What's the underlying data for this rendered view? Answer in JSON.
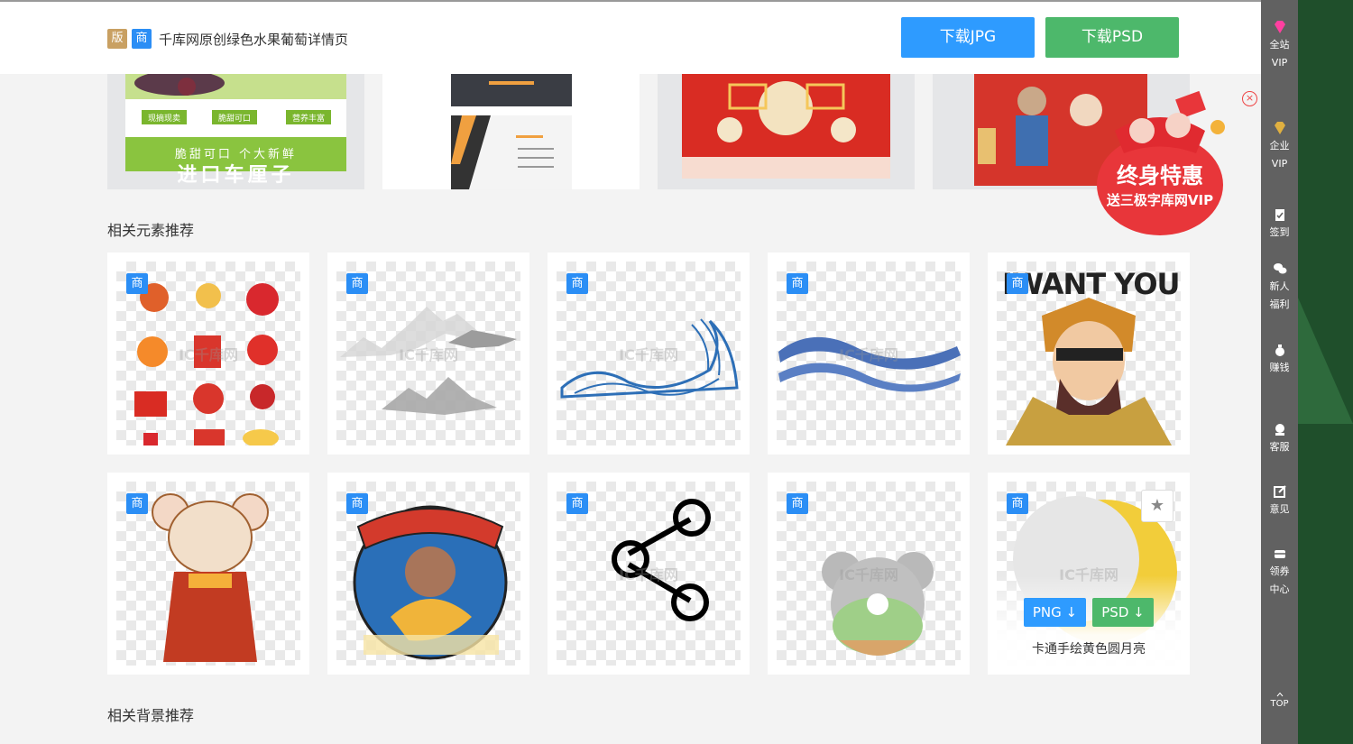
{
  "header": {
    "badge_ban": "版",
    "badge_shang": "商",
    "title": "千库网原创绿色水果葡萄详情页",
    "download_jpg": "下载JPG",
    "download_psd": "下载PSD"
  },
  "sidebar": {
    "items": [
      {
        "label_1": "全站",
        "label_2": "VIP",
        "icon": "diamond-icon"
      },
      {
        "label_1": "企业",
        "label_2": "VIP",
        "icon": "enterprise-diamond-icon"
      },
      {
        "label_1": "签到",
        "icon": "clipboard-check-icon"
      },
      {
        "label_1": "新人",
        "label_2": "福利",
        "icon": "wechat-icon"
      },
      {
        "label_1": "赚钱",
        "icon": "money-bag-icon"
      },
      {
        "label_1": "客服",
        "icon": "customer-service-icon"
      },
      {
        "label_1": "意见",
        "icon": "edit-icon"
      },
      {
        "label_1": "领券",
        "label_2": "中心",
        "icon": "coupon-icon"
      }
    ],
    "top": "TOP"
  },
  "templates_row": {
    "tpl1_tags": [
      "现摘现卖",
      "脆甜可口",
      "营养丰富"
    ],
    "tpl1_slogan": "脆甜可口 个大新鲜",
    "tpl1_headline": "进口车厘子"
  },
  "promo": {
    "line1": "终身特惠",
    "line2": "送三极字库网VIP",
    "close": "×"
  },
  "sections": {
    "elements_title": "相关元素推荐",
    "backgrounds_title": "相关背景推荐"
  },
  "cards": {
    "shang": "商",
    "watermark": "IC千库网",
    "wanted_text": "WANT YOU",
    "moon_caption": "卡通手绘黄色圆月亮",
    "png_btn": "PNG ↓",
    "psd_btn": "PSD ↓",
    "fav_icon": "★"
  },
  "colors": {
    "blue": "#2e9bff",
    "green": "#4db86b",
    "sidebar": "#616161",
    "promo_red": "#e8363a"
  }
}
